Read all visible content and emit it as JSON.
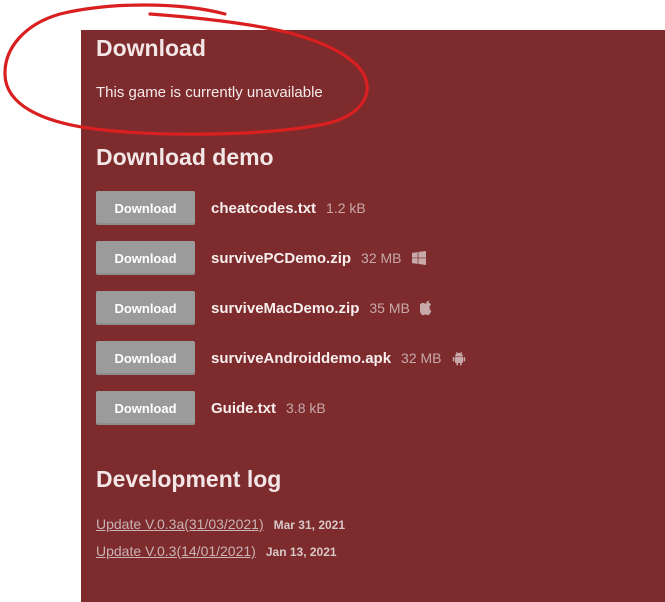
{
  "download_section": {
    "heading": "Download",
    "status_text": "This game is currently unavailable"
  },
  "demo_section": {
    "heading": "Download demo",
    "button_label": "Download",
    "files": [
      {
        "name": "cheatcodes.txt",
        "size": "1.2 kB",
        "platform": ""
      },
      {
        "name": "survivePCDemo.zip",
        "size": "32 MB",
        "platform": "windows-icon"
      },
      {
        "name": "surviveMacDemo.zip",
        "size": "35 MB",
        "platform": "apple-icon"
      },
      {
        "name": "surviveAndroiddemo.apk",
        "size": "32 MB",
        "platform": "android-icon"
      },
      {
        "name": "Guide.txt",
        "size": "3.8 kB",
        "platform": ""
      }
    ]
  },
  "devlog_section": {
    "heading": "Development log",
    "entries": [
      {
        "title": "Update V.0.3a(31/03/2021)",
        "date": "Mar 31, 2021"
      },
      {
        "title": "Update V.0.3(14/01/2021)",
        "date": "Jan 13, 2021"
      }
    ]
  },
  "colors": {
    "panel_bg": "#7d2b2d",
    "button_bg": "#9b9b9b",
    "annotation_red": "#d91f1f"
  }
}
